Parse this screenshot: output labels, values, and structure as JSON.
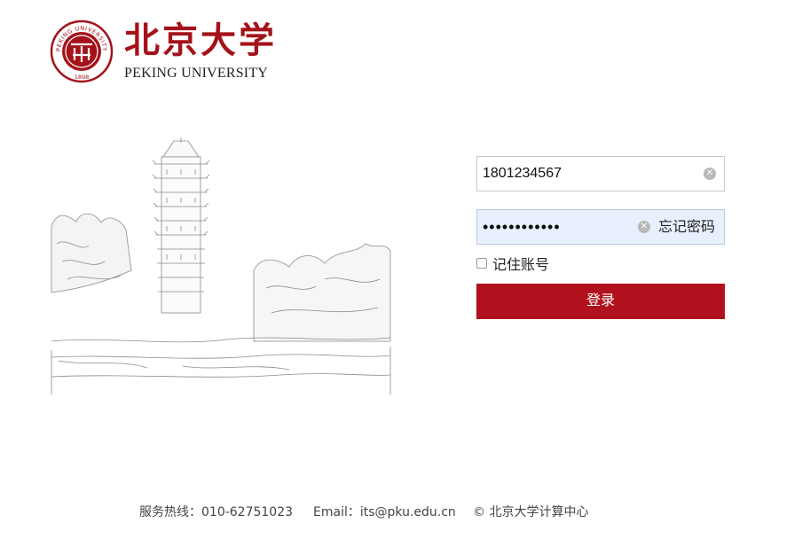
{
  "logo": {
    "name_cn": "北京大学",
    "name_en": "PEKING UNIVERSITY",
    "seal_text": "PEKING UNIVERSITY",
    "seal_year": "1898",
    "brand_color": "#a4131a"
  },
  "login": {
    "username_value": "1801234567",
    "password_masked": "••••••••••••",
    "clear_icon": "clear-circle-icon",
    "forgot_label": "忘记密码",
    "remember_label": "记住账号",
    "remember_checked": false,
    "submit_label": "登录",
    "submit_color": "#b1111c",
    "autofill_bg": "#e8f0fe"
  },
  "footer": {
    "phone": "服务热线：010-62751023",
    "email": "Email：its@pku.edu.cn",
    "copyright": "© 北京大学计算中心"
  }
}
